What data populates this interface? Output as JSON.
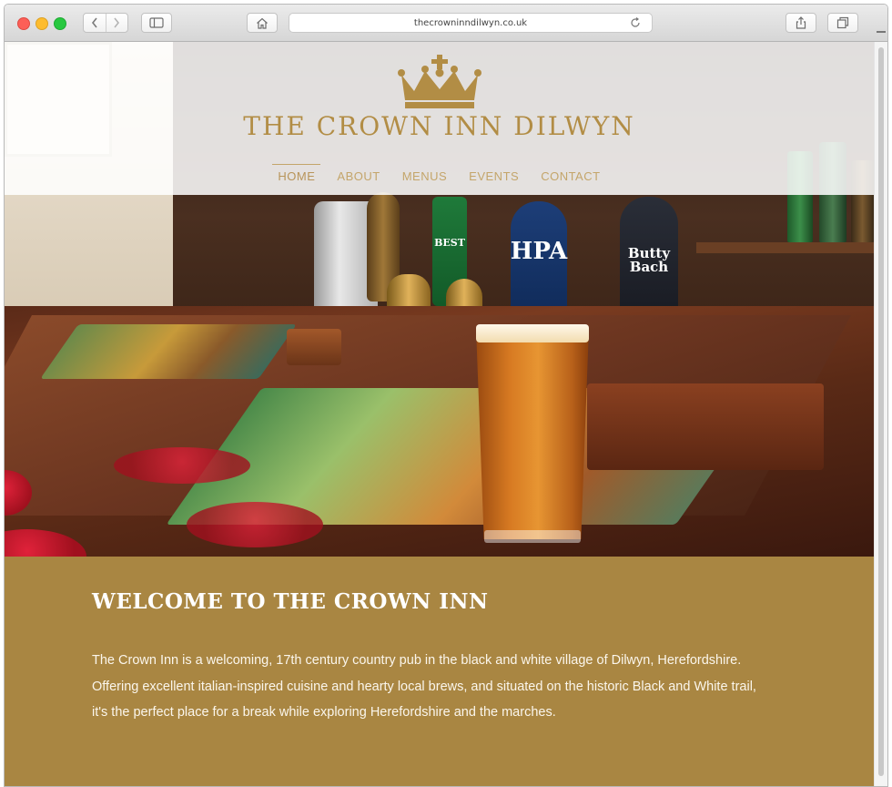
{
  "browser": {
    "url": "thecrowninndilwyn.co.uk",
    "icons": {
      "back": "chevron-left-icon",
      "forward": "chevron-right-icon",
      "sidebar": "sidebar-icon",
      "home": "home-icon",
      "reload": "reload-icon",
      "share": "share-icon",
      "tabs": "tabs-icon"
    }
  },
  "site": {
    "title": "THE CROWN INN DILWYN",
    "logo": "crown-icon",
    "brand_color": "#b28d45",
    "nav": [
      {
        "label": "HOME",
        "active": true
      },
      {
        "label": "ABOUT",
        "active": false
      },
      {
        "label": "MENUS",
        "active": false
      },
      {
        "label": "EVENTS",
        "active": false
      },
      {
        "label": "CONTACT",
        "active": false
      }
    ]
  },
  "hero": {
    "tap_labels": [
      "BEST",
      "HPA",
      "Butty Bach"
    ]
  },
  "welcome": {
    "title": "WELCOME TO THE CROWN INN",
    "paragraph_1": "The Crown Inn is a welcoming, 17th century country pub in the black and white village of Dilwyn, Herefordshire.",
    "paragraph_2": "Offering excellent italian-inspired cuisine and hearty local brews, and situated on the historic Black and White trail, it's the perfect place for a break while exploring Herefordshire and the marches.",
    "background_color": "#a98642"
  }
}
